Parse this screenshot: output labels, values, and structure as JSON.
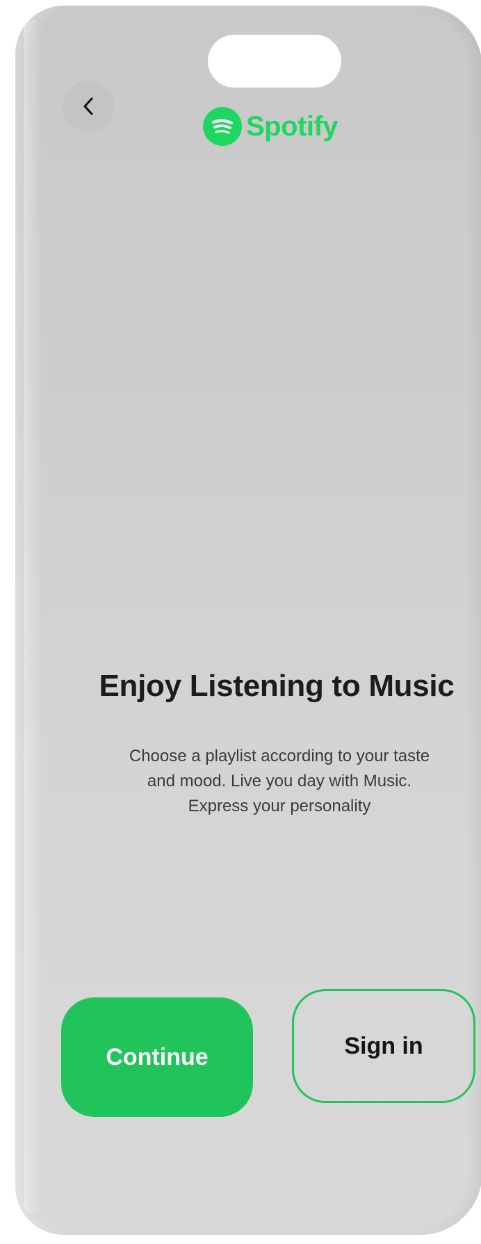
{
  "header": {
    "back_icon": "chevron-left-icon",
    "logo_icon": "spotify-logo-icon",
    "logo_text": "Spotify"
  },
  "content": {
    "title": "Enjoy Listening to Music",
    "description_lines": [
      "Choose a playlist according to your taste",
      "and mood. Live you day with Music.",
      "Express your personality"
    ]
  },
  "actions": {
    "continue_label": "Continue",
    "signin_label": "Sign in"
  },
  "colors": {
    "brand_green": "#1ed760",
    "button_green": "#21c45a",
    "screen_background": "#cdcdcd",
    "text_dark": "#1c1c1c"
  }
}
